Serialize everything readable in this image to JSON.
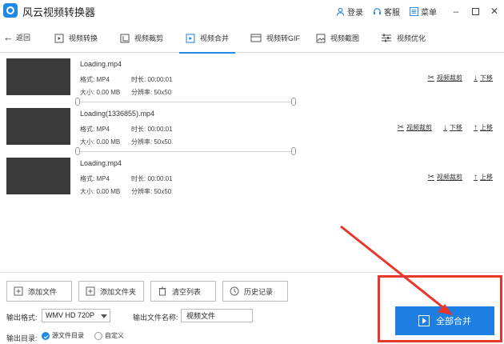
{
  "window": {
    "title": "风云视频转换器",
    "login": "登录",
    "service": "客服",
    "menu": "菜单",
    "minimize": "–",
    "close": "✕"
  },
  "tabs": {
    "back": "返回",
    "items": [
      {
        "label": "视频转换",
        "icon": "video-convert-icon"
      },
      {
        "label": "视频裁剪",
        "icon": "video-crop-icon"
      },
      {
        "label": "视频合并",
        "icon": "video-merge-icon"
      },
      {
        "label": "视频转GIF",
        "icon": "gif-icon"
      },
      {
        "label": "视频截图",
        "icon": "screenshot-icon"
      },
      {
        "label": "视频优化",
        "icon": "optimize-icon"
      }
    ],
    "active": "视频合并"
  },
  "files": [
    {
      "name": "Loading.mp4",
      "format": "格式: MP4",
      "duration": "时长: 00:00:01",
      "size": "大小: 0.00 MB",
      "resolution": "分辨率: 50x50",
      "actions": [
        "视频裁剪",
        "下移"
      ]
    },
    {
      "name": "Loading(1336855).mp4",
      "format": "格式: MP4",
      "duration": "时长: 00:00:01",
      "size": "大小: 0.00 MB",
      "resolution": "分辨率: 50x50",
      "actions": [
        "视频裁剪",
        "下移",
        "上移"
      ]
    },
    {
      "name": "Loading.mp4",
      "format": "格式: MP4",
      "duration": "时长: 00:00:01",
      "size": "大小: 0.00 MB",
      "resolution": "分辨率: 50x50",
      "actions": [
        "视频裁剪",
        "上移"
      ]
    }
  ],
  "bottom": {
    "add_file": "添加文件",
    "add_folder": "添加文件夹",
    "clear_list": "清空列表",
    "history": "历史记录",
    "format_label": "输出格式:",
    "format_value": "WMV HD 720P",
    "output_name_label": "输出文件名称:",
    "output_name_value": "视频文件",
    "dir_label": "输出目录:",
    "dir_option_source": "源文件目录",
    "dir_option_custom": "自定义",
    "merge_all": "全部合并"
  },
  "colors": {
    "accent": "#1e7fe0",
    "highlight": "#e8362d"
  }
}
